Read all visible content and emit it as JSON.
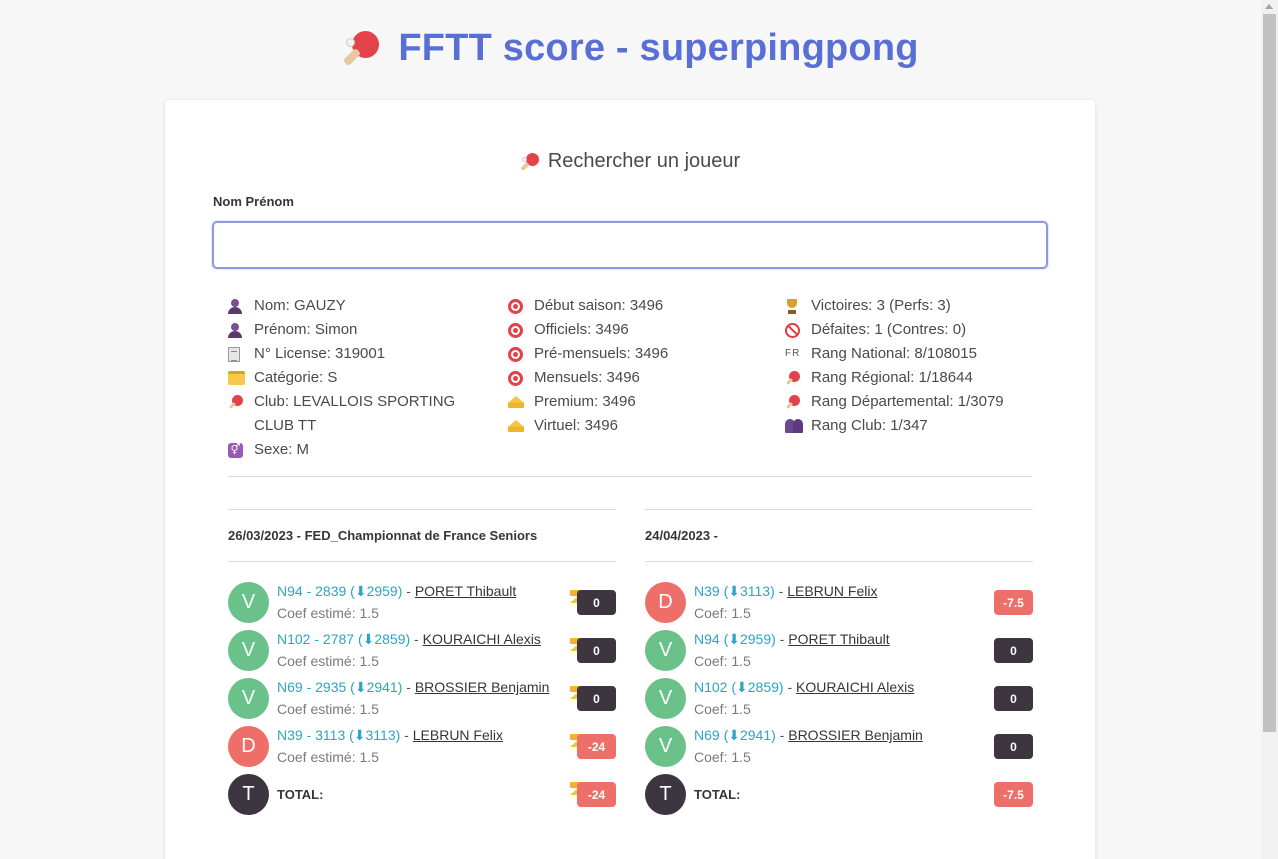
{
  "header": {
    "title": "FFTT score - superpingpong"
  },
  "search": {
    "title": "Rechercher un joueur",
    "label": "Nom Prénom",
    "value": "",
    "placeholder": ""
  },
  "player": {
    "col1": [
      {
        "icon": "user-icon",
        "text": "Nom: GAUZY"
      },
      {
        "icon": "user-icon",
        "text": "Prénom: Simon"
      },
      {
        "icon": "document-icon",
        "text": "N° License: 319001"
      },
      {
        "icon": "folder-icon",
        "text": "Catégorie: S"
      },
      {
        "icon": "paddle-icon",
        "text": "Club: LEVALLOIS SPORTING CLUB TT"
      },
      {
        "icon": "gender-icon",
        "text": "Sexe: M"
      }
    ],
    "col2": [
      {
        "icon": "target-icon",
        "text": "Début saison: 3496"
      },
      {
        "icon": "target-icon",
        "text": "Officiels: 3496"
      },
      {
        "icon": "target-icon",
        "text": "Pré-mensuels: 3496"
      },
      {
        "icon": "target-icon",
        "text": "Mensuels: 3496"
      },
      {
        "icon": "crown-icon",
        "text": "Premium: 3496"
      },
      {
        "icon": "crown-icon",
        "text": "Virtuel: 3496"
      }
    ],
    "col3": [
      {
        "icon": "trophy-icon",
        "text": "Victoires: 3 (Perfs: 3)"
      },
      {
        "icon": "no-entry-icon",
        "text": "Défaites: 1 (Contres: 0)"
      },
      {
        "icon": "fr-flag-icon",
        "text": "Rang National: 8/108015"
      },
      {
        "icon": "paddle-icon",
        "text": "Rang Régional: 1/18644"
      },
      {
        "icon": "paddle-icon",
        "text": "Rang Départemental: 1/3079"
      },
      {
        "icon": "group-icon",
        "text": "Rang Club: 1/347"
      }
    ]
  },
  "matches": [
    {
      "title": "26/03/2023 - FED_Championnat de France Seniors",
      "opponents": [
        {
          "result": "V",
          "rank": "N94 - 2839",
          "points": "(⬇2959)",
          "sep": " - ",
          "name": "PORET Thibault",
          "coef": "Coef estimé: 1.5",
          "score": "0",
          "crown": true
        },
        {
          "result": "V",
          "rank": "N102 - 2787",
          "points": "(⬇2859)",
          "sep": " - ",
          "name": "KOURAICHI Alexis",
          "coef": "Coef estimé: 1.5",
          "score": "0",
          "crown": true
        },
        {
          "result": "V",
          "rank": "N69 - 2935",
          "points": "(⬇2941)",
          "sep": " - ",
          "name": "BROSSIER Benjamin",
          "coef": "Coef estimé: 1.5",
          "score": "0",
          "crown": true
        },
        {
          "result": "D",
          "rank": "N39 - 3113",
          "points": "(⬇3113)",
          "sep": " - ",
          "name": "LEBRUN Felix",
          "coef": "Coef estimé: 1.5",
          "score": "-24",
          "crown": true
        }
      ],
      "total": {
        "avatar": "T",
        "label": "TOTAL:",
        "score": "-24",
        "crown": true
      }
    },
    {
      "title": "24/04/2023 -",
      "opponents": [
        {
          "result": "D",
          "rank": "N39",
          "points": "(⬇3113)",
          "sep": " - ",
          "name": "LEBRUN Felix",
          "coef": "Coef: 1.5",
          "score": "-7.5",
          "crown": false
        },
        {
          "result": "V",
          "rank": "N94",
          "points": "(⬇2959)",
          "sep": " - ",
          "name": "PORET Thibault",
          "coef": "Coef: 1.5",
          "score": "0",
          "crown": false
        },
        {
          "result": "V",
          "rank": "N102",
          "points": "(⬇2859)",
          "sep": " - ",
          "name": "KOURAICHI Alexis",
          "coef": "Coef: 1.5",
          "score": "0",
          "crown": false
        },
        {
          "result": "V",
          "rank": "N69",
          "points": "(⬇2941)",
          "sep": " - ",
          "name": "BROSSIER Benjamin",
          "coef": "Coef: 1.5",
          "score": "0",
          "crown": false
        }
      ],
      "total": {
        "avatar": "T",
        "label": "TOTAL:",
        "score": "-7.5",
        "crown": false
      }
    }
  ],
  "colors": {
    "title": "#5a6fd6",
    "win": "#6bc18a",
    "loss": "#ee6f6a",
    "dark": "#3d3540",
    "link": "#2aa5c4"
  }
}
